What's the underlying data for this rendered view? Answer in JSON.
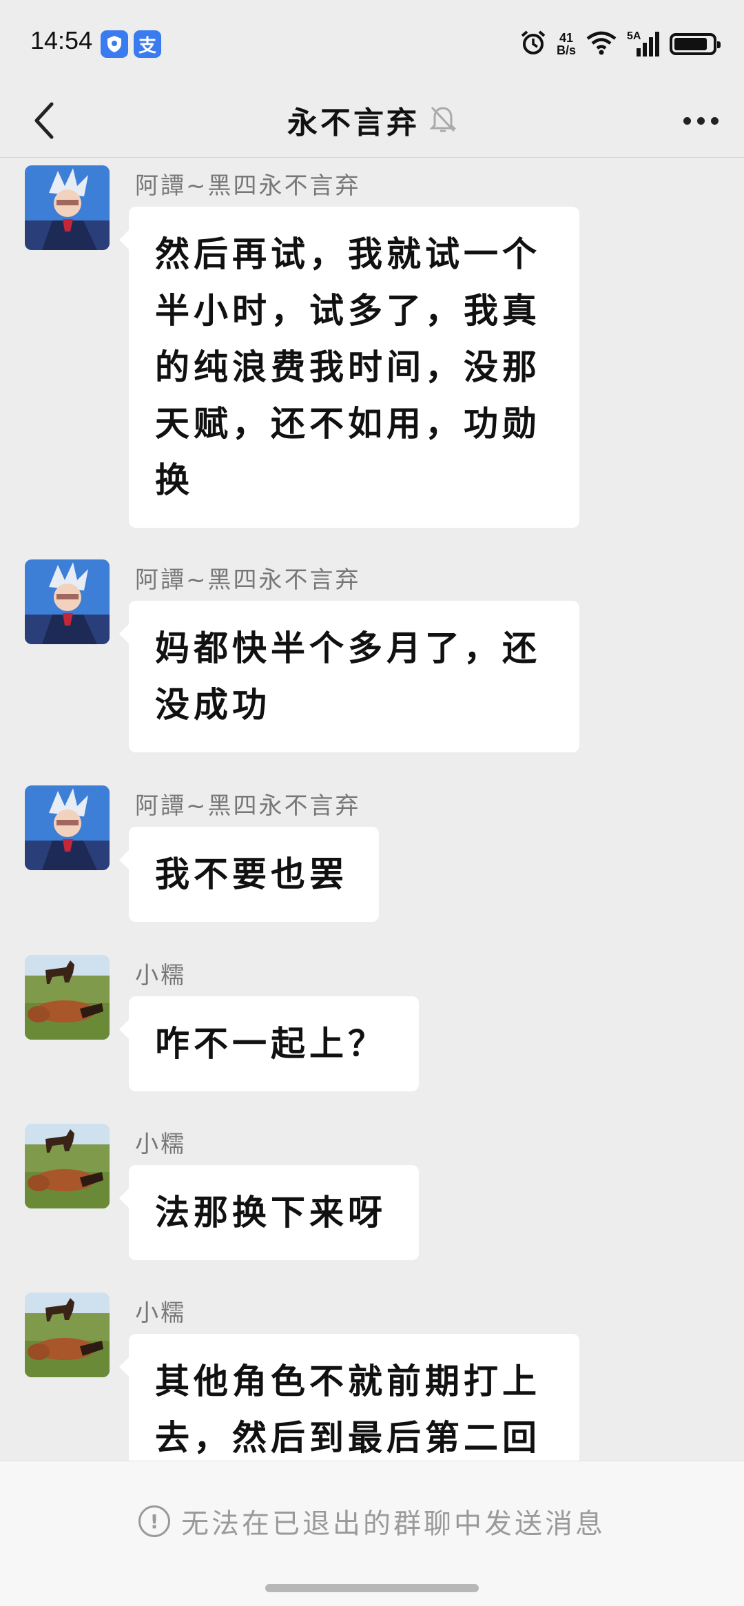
{
  "status_bar": {
    "time": "14:54",
    "app_badges": [
      "shield-app-icon",
      "支"
    ],
    "net_speed_value": "41",
    "net_speed_unit": "B/s",
    "signal_label": "5A",
    "icons": [
      "alarm-icon",
      "wifi-icon",
      "signal-icon",
      "battery-icon"
    ]
  },
  "header": {
    "title": "永不言弃",
    "muted_icon": "bell-muted-icon",
    "back_icon": "chevron-left-icon",
    "more_icon": "more-icon"
  },
  "messages": [
    {
      "sender": "阿譚~黑四永不言弃",
      "avatar": "anime-avatar",
      "lines": [
        "然后再试，我就试一个",
        "半小时，试多了，我真",
        "的纯浪费我时间，没那",
        "天赋，还不如用，功勋",
        "换"
      ]
    },
    {
      "sender": "阿譚~黑四永不言弃",
      "avatar": "anime-avatar",
      "lines": [
        "妈都快半个多月了，还",
        "没成功"
      ]
    },
    {
      "sender": "阿譚~黑四永不言弃",
      "avatar": "anime-avatar",
      "lines": [
        "我不要也罢"
      ]
    },
    {
      "sender": "小糯",
      "avatar": "horse-avatar",
      "lines": [
        "咋不一起上？"
      ]
    },
    {
      "sender": "小糯",
      "avatar": "horse-avatar",
      "lines": [
        "法那换下来呀"
      ]
    },
    {
      "sender": "小糯",
      "avatar": "horse-avatar",
      "lines": [
        "其他角色不就前期打上",
        "去，然后到最后第二回"
      ]
    }
  ],
  "footer": {
    "notice": "无法在已退出的群聊中发送消息",
    "notice_icon": "info-icon"
  }
}
